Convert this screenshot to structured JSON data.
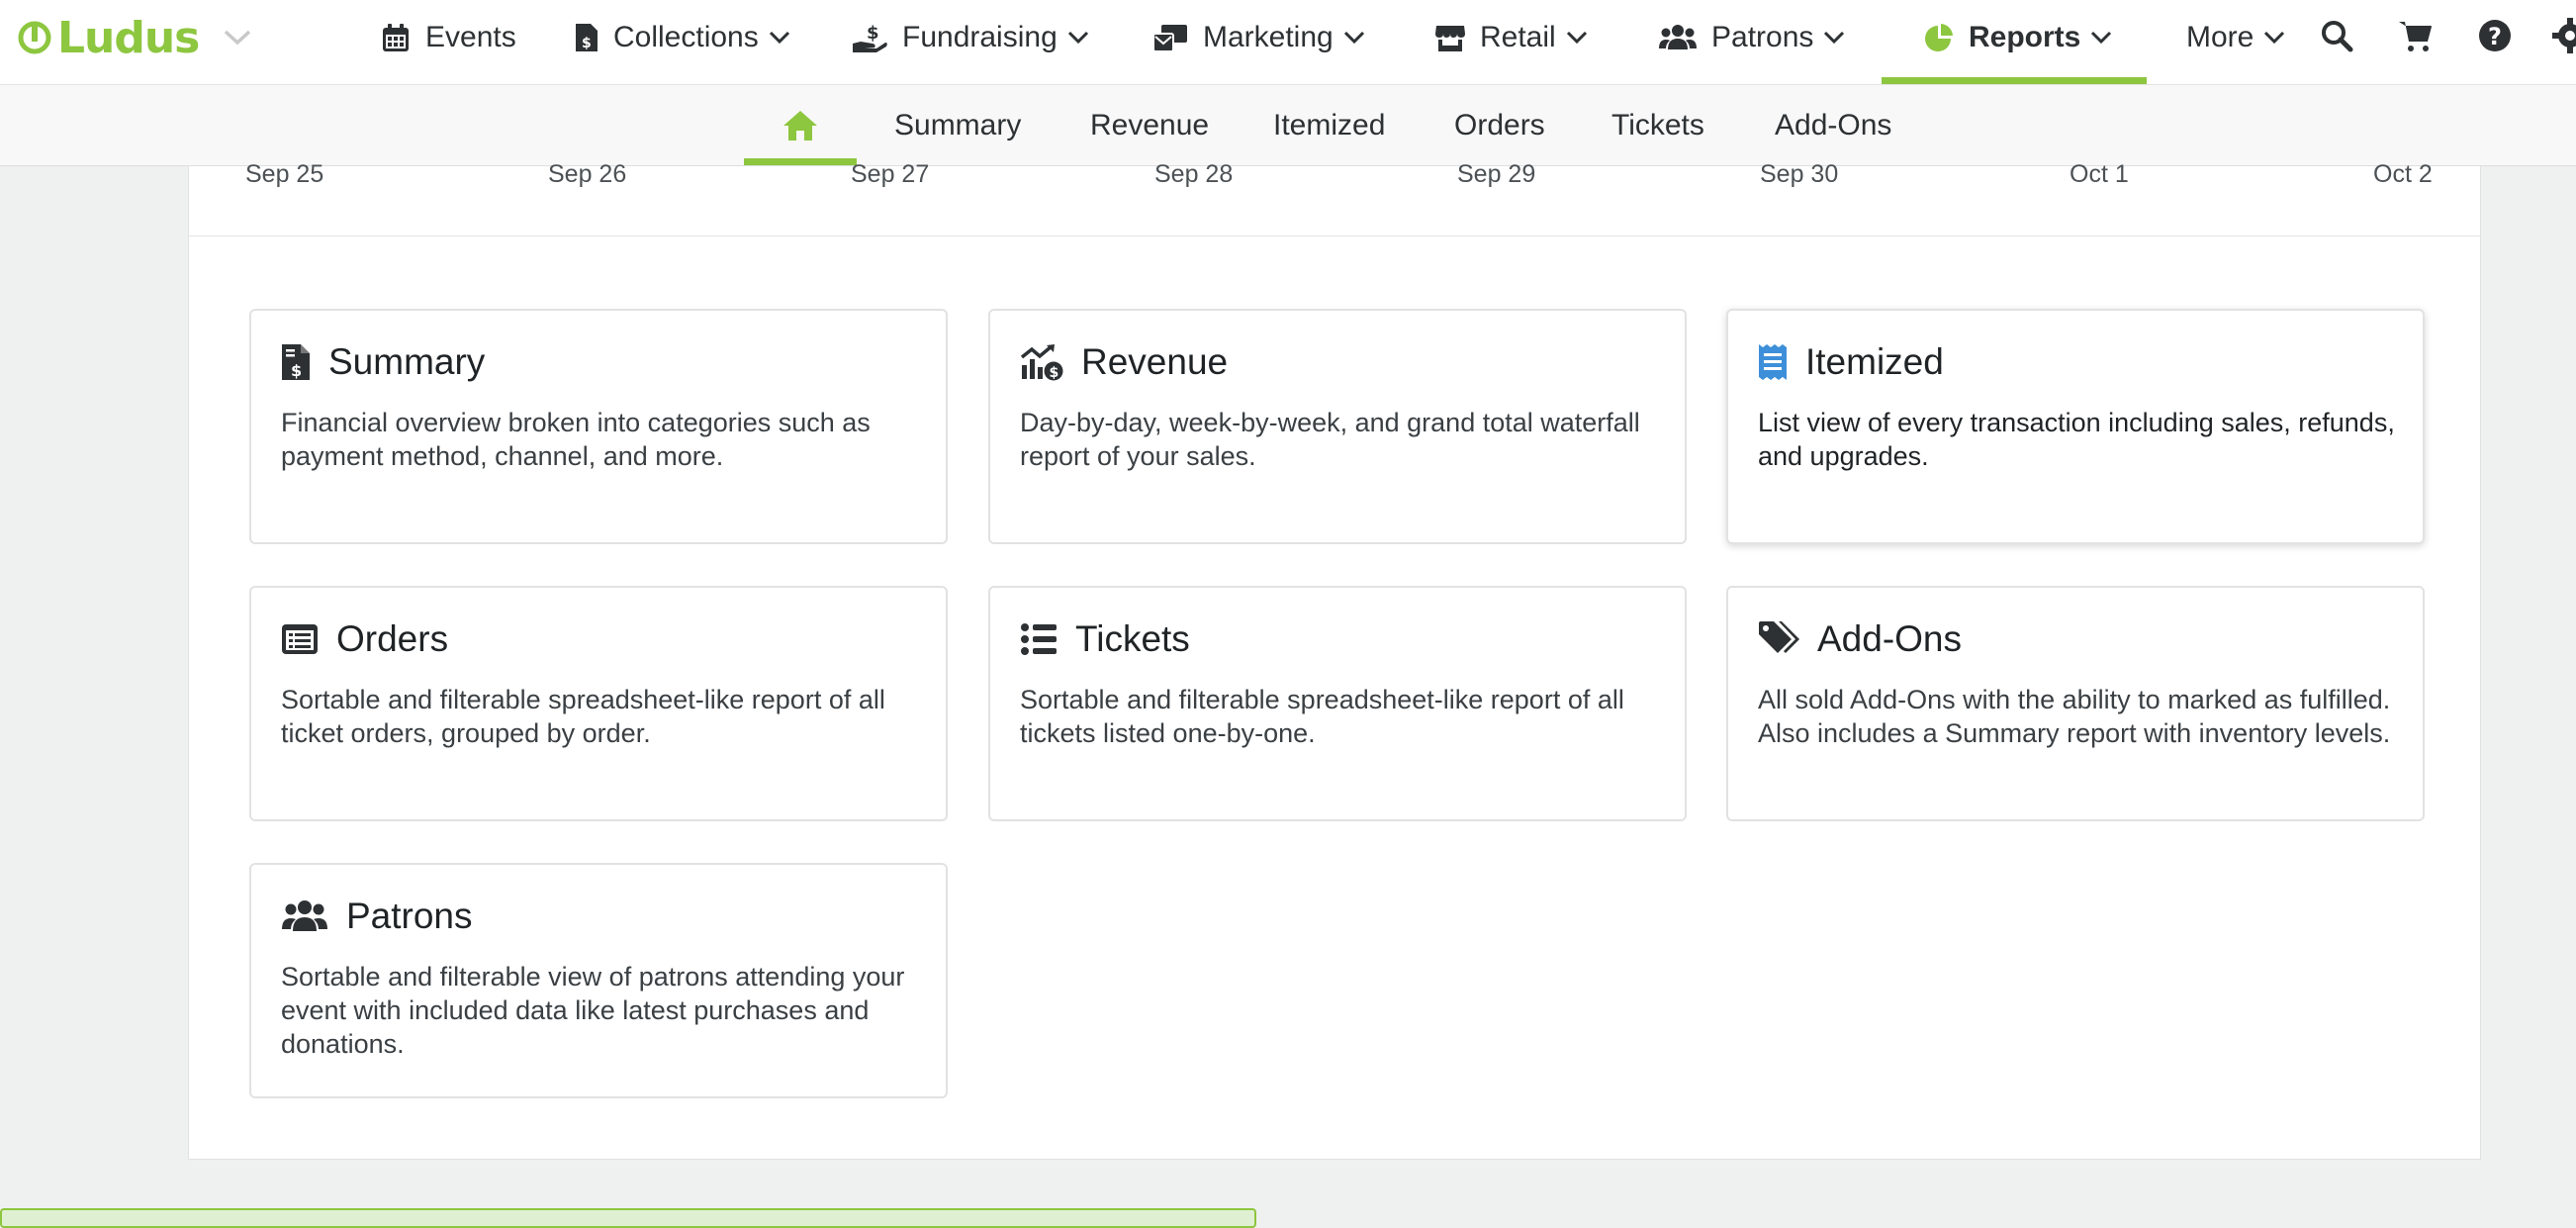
{
  "app": {
    "logo_text": "Ludus"
  },
  "topnav": {
    "items": [
      {
        "label": "Events",
        "icon": "calendar-icon",
        "has_dropdown": false
      },
      {
        "label": "Collections",
        "icon": "receipt-dollar-icon",
        "has_dropdown": true
      },
      {
        "label": "Fundraising",
        "icon": "hand-holding-dollar-icon",
        "has_dropdown": true
      },
      {
        "label": "Marketing",
        "icon": "mail-bulk-icon",
        "has_dropdown": true
      },
      {
        "label": "Retail",
        "icon": "store-icon",
        "has_dropdown": true
      },
      {
        "label": "Patrons",
        "icon": "users-icon",
        "has_dropdown": true
      },
      {
        "label": "Reports",
        "icon": "chart-pie-icon",
        "has_dropdown": true,
        "active": true
      },
      {
        "label": "More",
        "icon": "",
        "has_dropdown": true
      }
    ],
    "tools": [
      "search-icon",
      "cart-icon",
      "help-icon",
      "settings-icon"
    ]
  },
  "subnav": {
    "home_icon": "home-icon",
    "items": [
      "Summary",
      "Revenue",
      "Itemized",
      "Orders",
      "Tickets",
      "Add-Ons"
    ]
  },
  "chart_axis": {
    "dates": [
      "Sep 25",
      "Sep 26",
      "Sep 27",
      "Sep 28",
      "Sep 29",
      "Sep 30",
      "Oct 1",
      "Oct 2"
    ]
  },
  "reports": [
    {
      "title": "Summary",
      "icon": "file-invoice-dollar-icon",
      "description": "Financial overview broken into categories such as payment method, channel, and more."
    },
    {
      "title": "Revenue",
      "icon": "chart-line-dollar-icon",
      "description": "Day-by-day, week-by-week, and grand total waterfall report of your sales."
    },
    {
      "title": "Itemized",
      "icon": "receipt-icon",
      "description": "List view of every transaction including sales, refunds, and upgrades.",
      "highlighted": true
    },
    {
      "title": "Orders",
      "icon": "list-alt-icon",
      "description": "Sortable and filterable spreadsheet-like report of all ticket orders, grouped by order."
    },
    {
      "title": "Tickets",
      "icon": "list-ul-icon",
      "description": "Sortable and filterable spreadsheet-like report of all tickets listed one-by-one."
    },
    {
      "title": "Add-Ons",
      "icon": "tags-icon",
      "description": "All sold Add-Ons with the ability to marked as fulfilled. Also includes a Summary report with inventory levels."
    },
    {
      "title": "Patrons",
      "icon": "users-icon",
      "description": "Sortable and filterable view of patrons attending your event with included data like latest purchases and donations."
    }
  ],
  "colors": {
    "brand": "#8dc63f",
    "accent_icon": "#3d8fd9",
    "text": "#1f2326",
    "background": "#eff0f0"
  }
}
